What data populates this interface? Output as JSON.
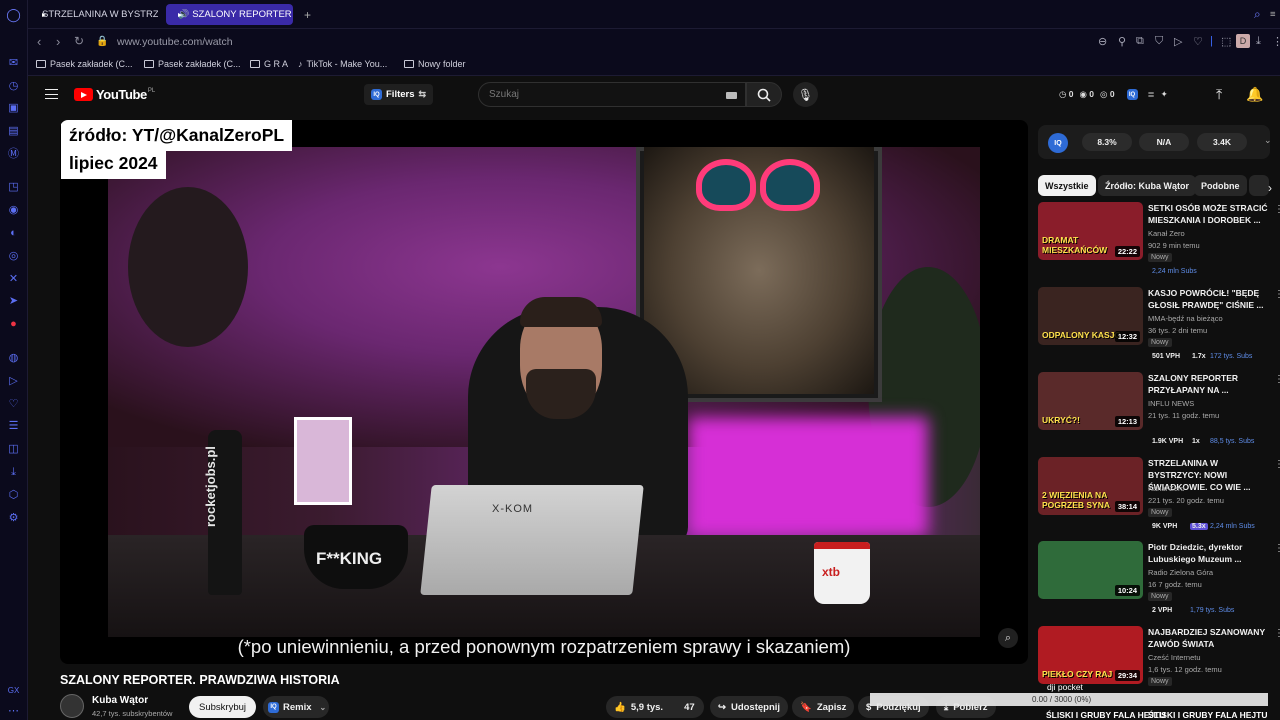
{
  "browser": {
    "tabs": [
      {
        "label": "STRZELANINA W BYSTRZ",
        "active": false
      },
      {
        "label": "SZALONY REPORTER",
        "active": true
      }
    ],
    "new_tab_icon": "plus-icon",
    "url": "www.youtube.com/watch",
    "bookmarks": [
      "Pasek zakładek (C...",
      "Pasek zakładek (C...",
      "G R A",
      "TikTok - Make You...",
      "Nowy folder"
    ],
    "profile_initial": "D"
  },
  "youtube": {
    "logo_text": "YouTube",
    "logo_region": "PL",
    "filters_label": "Filters",
    "search_placeholder": "Szukaj",
    "header_stats": [
      "0",
      "0",
      "0"
    ]
  },
  "video": {
    "overlay_source": "źródło: YT/@KanalZeroPL",
    "overlay_date": "lipiec 2024",
    "caption": "(*po uniewinnieniu, a przed ponownym rozpatrzeniem sprawy i skazaniem)",
    "scene_texts": {
      "bottle": "rocketjobs.pl",
      "bowl": "F**KING",
      "laptop": "X-KOM",
      "mug": "xtb"
    },
    "title": "SZALONY REPORTER. PRAWDZIWA HISTORIA",
    "channel_name": "Kuba Wątor",
    "channel_subs": "42,7 tys. subskrybentów",
    "subscribe_label": "Subskrybuj",
    "remix_label": "Remix",
    "likes": "5,9 tys.",
    "dislikes": "47",
    "share_label": "Udostępnij",
    "save_label": "Zapisz",
    "thanks_label": "Podziękuj",
    "download_label": "Pobierz"
  },
  "overlay": {
    "brand": "dji pocket",
    "progress_text": "0.00 / 3000 (0%)"
  },
  "iq_panel": {
    "logo": "IQ",
    "stats": [
      "8.3%",
      "N/A",
      "3.4K"
    ]
  },
  "chips": [
    "Wszystkie",
    "Źródło: Kuba Wątor",
    "Podobne"
  ],
  "recommendations": [
    {
      "title": "SETKI OSÓB MOŻE STRACIĆ MIESZKANIA I DOROBEK ...",
      "channel": "Kanał Zero",
      "meta": "902  9 min temu",
      "badge": "Nowy",
      "duration": "22:22",
      "extra": [
        "2,24 mln Subs"
      ],
      "thumb_color": "#8a1d2a",
      "thumb_text": "DRAMAT MIESZKAŃCÓW"
    },
    {
      "title": "KASJO POWRÓCIŁ! \"BĘDĘ GŁOSIŁ PRAWDĘ\" CIŚNIE ...",
      "channel": "MMA-będź na bieżąco",
      "meta": "36 tys.  2 dni temu",
      "badge": "Nowy",
      "duration": "12:32",
      "extra": [
        "501 VPH",
        "1.7x",
        "172 tys. Subs"
      ],
      "thumb_color": "#3a2420",
      "thumb_text": "ODPALONY KASJO"
    },
    {
      "title": "SZALONY REPORTER PRZYŁAPANY NA ...",
      "channel": "INFLU NEWS",
      "meta": "21 tys.  11 godz. temu",
      "badge": "",
      "duration": "12:13",
      "extra": [
        "1.9K VPH",
        "1x",
        "88,5 tys. Subs"
      ],
      "thumb_color": "#5a2a2a",
      "thumb_text": "UKRYĆ?!"
    },
    {
      "title": "STRZELANINA W BYSTRZYCY: NOWI ŚWIADKOWIE. CO WIE ...",
      "channel": "Kanał Zero",
      "meta": "221 tys.  20 godz. temu",
      "badge": "Nowy",
      "duration": "38:14",
      "extra": [
        "9K VPH",
        "5.3x",
        "2,24 mln Subs"
      ],
      "thumb_color": "#6b2226",
      "thumb_text": "2 WIĘZIENIA NA POGRZEB SYNA"
    },
    {
      "title": "Piotr Dziedzic, dyrektor Lubuskiego Muzeum ...",
      "channel": "Radio Zielona Góra",
      "meta": "16  7 godz. temu",
      "badge": "Nowy",
      "duration": "10:24",
      "extra": [
        "2 VPH",
        "1,79 tys. Subs"
      ],
      "thumb_color": "#2f6b3a",
      "thumb_text": ""
    },
    {
      "title": "NAJBARDZIEJ SZANOWANY ZAWÓD ŚWIATA",
      "channel": "Cześć Internetu",
      "meta": "1,6 tys.  12 godz. temu",
      "badge": "Nowy",
      "duration": "29:34",
      "extra": [],
      "thumb_color": "#b01b22",
      "thumb_text": "PIEKŁO CZY RAJ"
    }
  ],
  "bottom_partial": [
    "ŚLISKI I GRUBY FALA HEJTU",
    "ŚLISKI I GRUBY FALA HEJTU"
  ]
}
